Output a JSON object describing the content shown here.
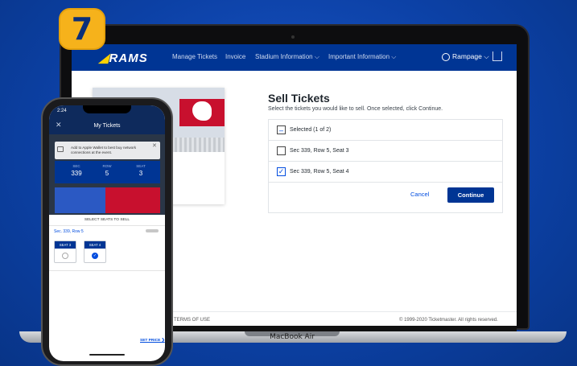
{
  "step_badge": "7",
  "laptop": {
    "model_label": "MacBook Air"
  },
  "nav": {
    "logo_text": "RAMS",
    "items": [
      "Manage Tickets",
      "Invoice",
      "Stadium Information ⌵",
      "Important Information ⌵"
    ],
    "user_label": "Rampage ⌵"
  },
  "sell": {
    "title": "Sell Tickets",
    "subtitle": "Select the tickets you would like to sell. Once selected, click Continue.",
    "selected_label": "Selected (1 of 2)",
    "seats": [
      {
        "label": "Sec 339, Row 5, Seat 3",
        "checked": false
      },
      {
        "label": "Sec 339, Row 5, Seat 4",
        "checked": true
      }
    ],
    "cancel_label": "Cancel",
    "continue_label": "Continue"
  },
  "footer": {
    "left": "TERMS OF USE",
    "right": "© 1999-2020 Ticketmaster. All rights reserved."
  },
  "phone": {
    "time": "2:24",
    "header_title": "My Tickets",
    "wallet_banner": "Add to Apple Wallet to best buy network connections at the event.",
    "seat_info": [
      {
        "key": "SEC",
        "value": "339"
      },
      {
        "key": "ROW",
        "value": "5"
      },
      {
        "key": "SEAT",
        "value": "3"
      }
    ],
    "select_title": "SELECT SEATS TO SELL",
    "section_label": "Sec. 339, Row 5",
    "seats": [
      {
        "label": "SEAT 3",
        "checked": false
      },
      {
        "label": "SEAT 4",
        "checked": true
      }
    ],
    "set_price_label": "SET PRICE ❯"
  },
  "colors": {
    "accent": "#003594",
    "link": "#024ddf",
    "badge": "#f6b21b",
    "cardinals_red": "#c8102e"
  }
}
